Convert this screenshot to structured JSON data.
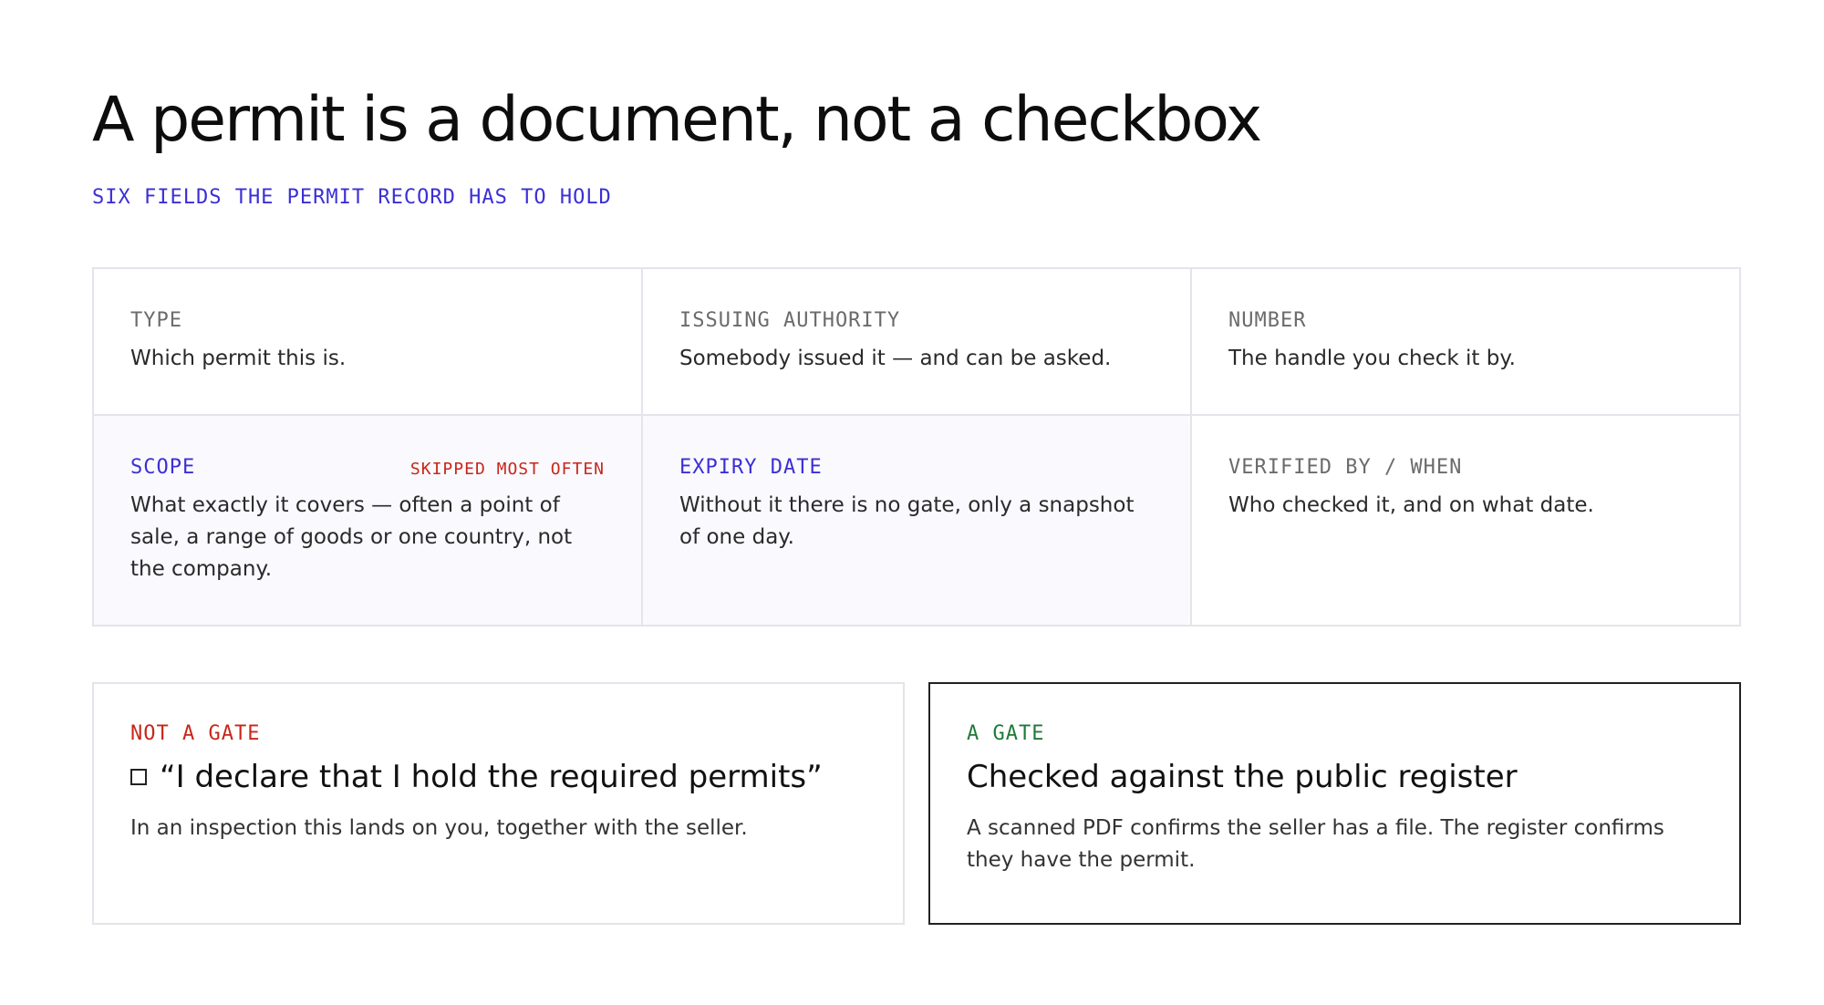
{
  "header": {
    "title": "A permit is a document, not a checkbox",
    "subtitle": "SIX FIELDS THE PERMIT RECORD HAS TO HOLD"
  },
  "fields": [
    {
      "label": "TYPE",
      "description": "Which permit this is."
    },
    {
      "label": "ISSUING AUTHORITY",
      "description": "Somebody issued it — and can be asked."
    },
    {
      "label": "NUMBER",
      "description": "The handle you check it by."
    },
    {
      "label": "SCOPE",
      "flag": "SKIPPED MOST OFTEN",
      "description": "What exactly it covers — often a point of sale, a range of goods or one country, not the company."
    },
    {
      "label": "EXPIRY DATE",
      "description": "Without it there is no gate, only a snapshot of one day."
    },
    {
      "label": "VERIFIED BY / WHEN",
      "description": "Who checked it, and on what date."
    }
  ],
  "not_gate": {
    "label": "NOT A GATE",
    "heading": "“I declare that I hold the required permits”",
    "body": "In an inspection this lands on you, together with the seller."
  },
  "gate": {
    "label": "A GATE",
    "heading": "Checked against the public register",
    "body": "A scanned PDF confirms the seller has a file. The register confirms they have the permit."
  },
  "colors": {
    "accent": "#3b2fd6",
    "warning": "#c8261a",
    "positive": "#1f7a3a"
  }
}
